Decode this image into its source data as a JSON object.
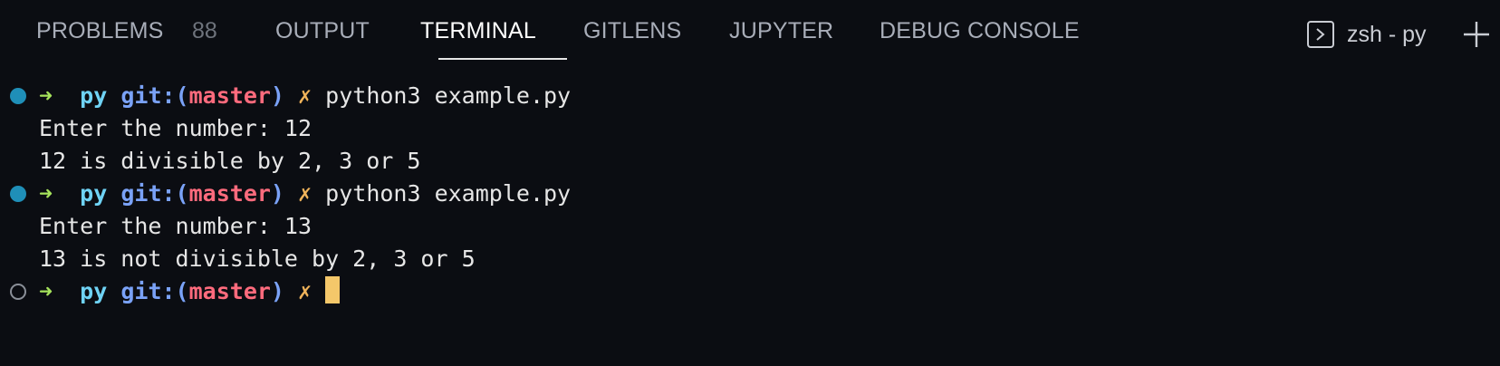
{
  "panel": {
    "tabs": [
      {
        "label": "PROBLEMS",
        "count": "88"
      },
      {
        "label": "OUTPUT"
      },
      {
        "label": "TERMINAL",
        "active": true
      },
      {
        "label": "GITLENS"
      },
      {
        "label": "JUPYTER"
      },
      {
        "label": "DEBUG CONSOLE"
      }
    ],
    "terminal_name": "zsh - py",
    "icons": {
      "terminal": "terminal-icon",
      "new_terminal": "plus-icon"
    }
  },
  "colors": {
    "background": "#0b0d12",
    "prompt_arrow": "#a6e35c",
    "prompt_dir": "#6fd3f5",
    "git_label": "#7aa2f7",
    "branch": "#ff6b7d",
    "dirty_mark": "#f0b35a",
    "decoration_success": "#1f8fb8",
    "cursor": "#f4c76a"
  },
  "prompt": {
    "arrow": "➜",
    "dir": "py",
    "git_open": "git:(",
    "branch": "master",
    "git_close": ")",
    "dirty": "✗"
  },
  "terminal": {
    "commands": [
      {
        "command": "python3 example.py",
        "output": [
          "Enter the number: 12",
          "12 is divisible by 2, 3 or 5"
        ]
      },
      {
        "command": "python3 example.py",
        "output": [
          "Enter the number: 13",
          "13 is not divisible by 2, 3 or 5"
        ]
      }
    ]
  }
}
